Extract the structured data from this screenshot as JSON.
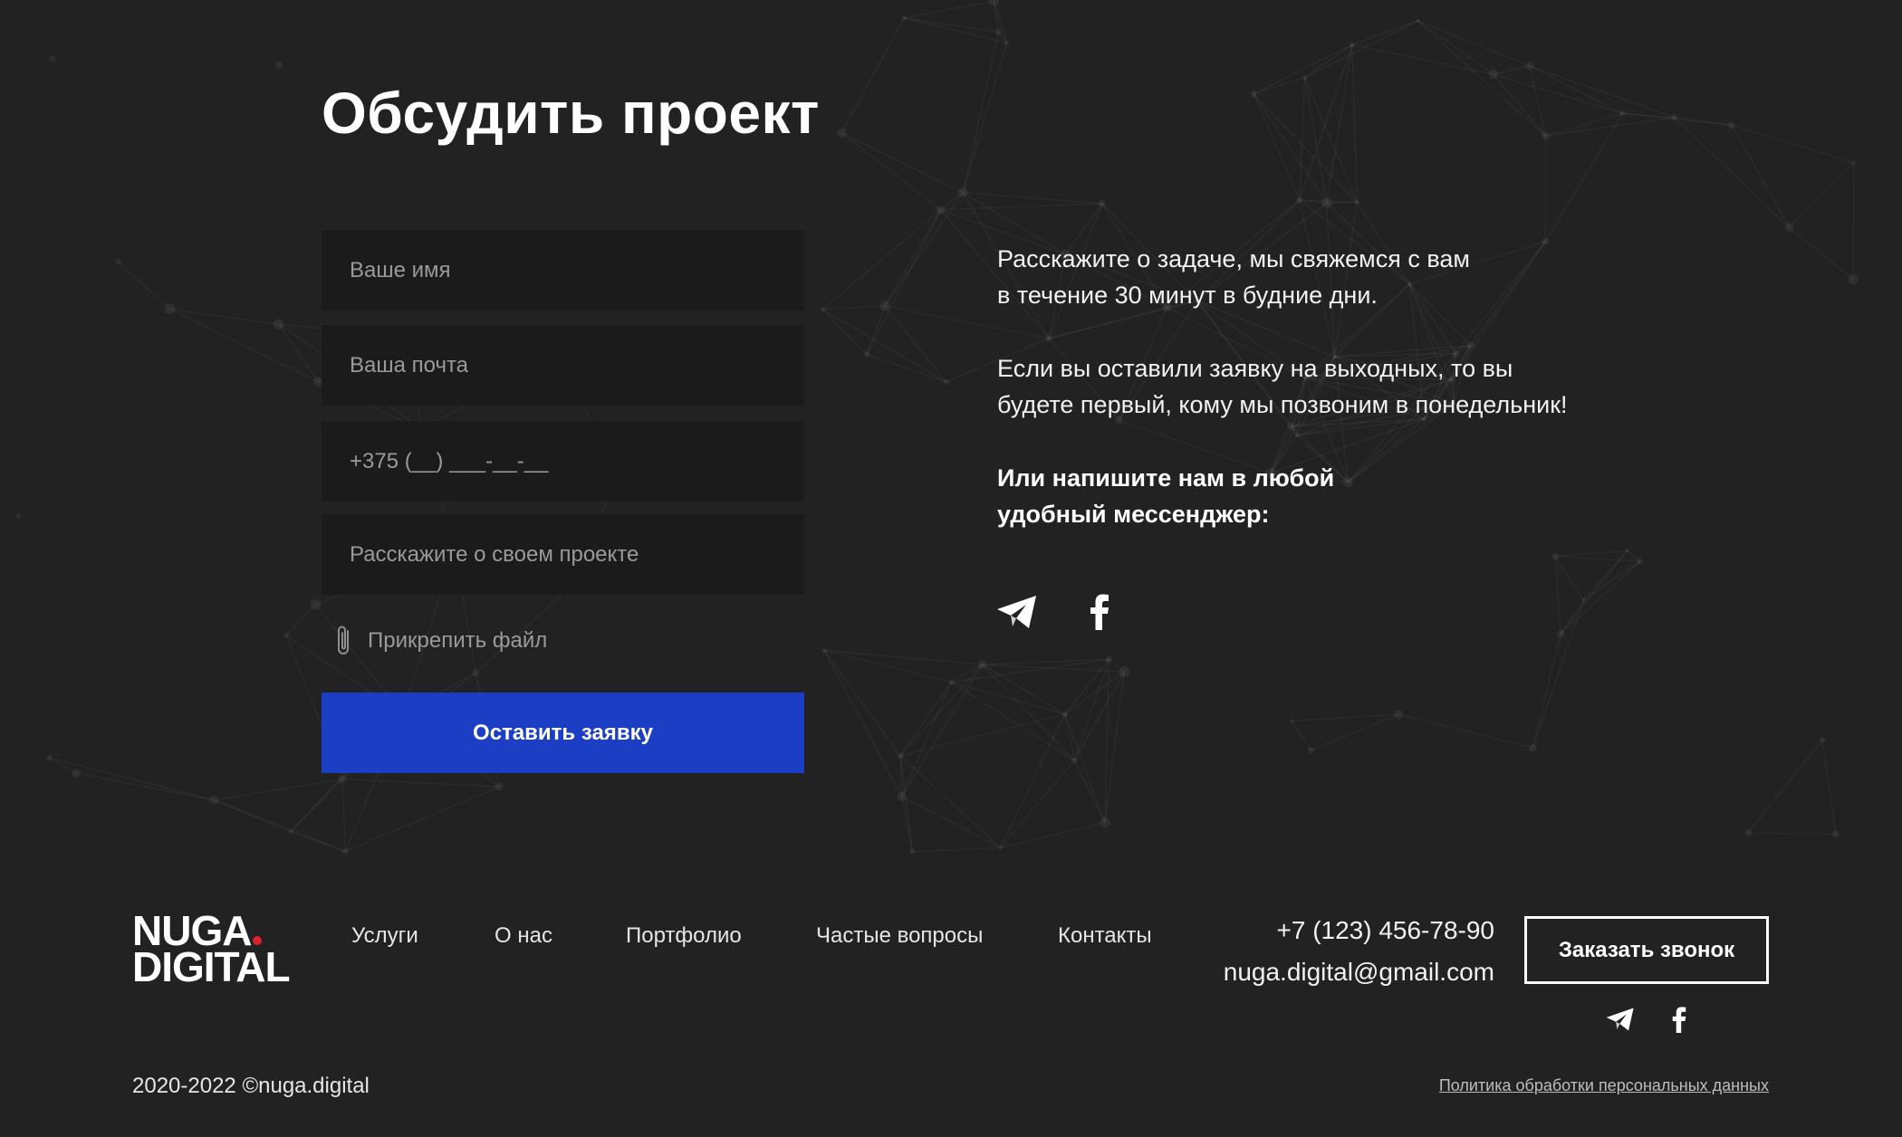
{
  "colors": {
    "background": "#222222",
    "field_bg": "#1b1b1b",
    "accent_blue": "#1c3ec4",
    "logo_dot": "#e0202a"
  },
  "form": {
    "title": "Обсудить проект",
    "name_placeholder": "Ваше имя",
    "email_placeholder": "Ваша почта",
    "phone_placeholder": "+375 (__) ___-__-__",
    "project_placeholder": "Расскажите о своем проекте",
    "attach_label": "Прикрепить файл",
    "submit_label": "Оставить заявку"
  },
  "info": {
    "line1": "Расскажите о задаче, мы свяжемся с вам",
    "line2": "в течение 30 минут в будние дни.",
    "line3": "Если вы оставили заявку на выходных, то вы",
    "line4": "будете первый, кому мы позвоним в понедельник!",
    "line5": "Или напишите нам в любой",
    "line6": "удобный мессенджер:",
    "icons": [
      "telegram-icon",
      "facebook-icon"
    ]
  },
  "footer": {
    "logo_line1": "NUGA",
    "logo_line2": "DIGITAL",
    "nav": [
      "Услуги",
      "О нас",
      "Портфолио",
      "Частые вопросы",
      "Контакты"
    ],
    "phone": "+7 (123) 456-78-90",
    "email": "nuga.digital@gmail.com",
    "call_button": "Заказать звонок",
    "copyright": "2020-2022 ©nuga.digital",
    "policy": "Политика обработки персональных данных"
  }
}
